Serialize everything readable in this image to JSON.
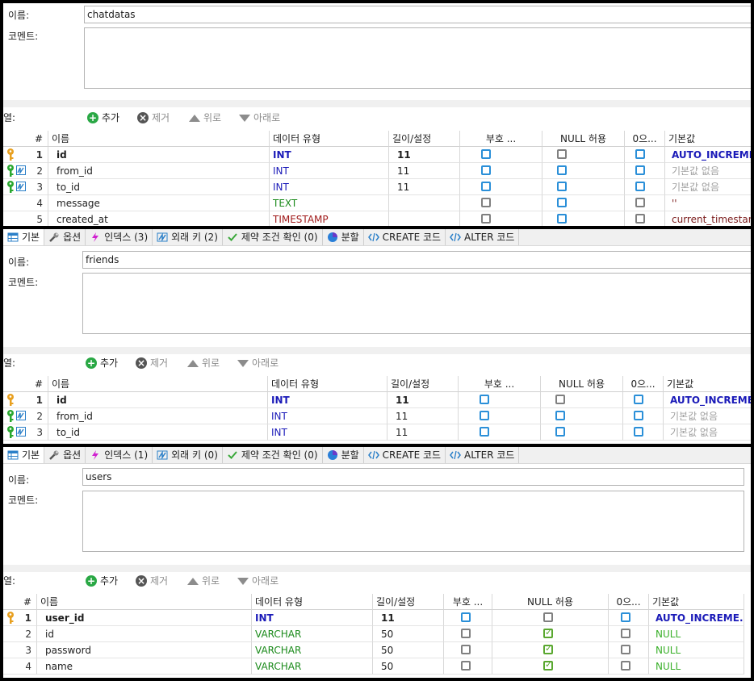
{
  "labels": {
    "name": "이름:",
    "comment": "코멘트:",
    "columns": "열:",
    "add": "추가",
    "remove": "제거",
    "up": "위로",
    "down": "아래로"
  },
  "headers": {
    "num": "#",
    "name": "이름",
    "type": "데이터 유형",
    "length": "길이/설정",
    "unsigned": "부호 ...",
    "nullable": "NULL 허용",
    "zerofill": "0으...",
    "default": "기본값"
  },
  "tabs": [
    {
      "label": "기본",
      "icon": "table-icon"
    },
    {
      "label": "옵션",
      "icon": "wrench-icon"
    },
    {
      "label": "인덱스",
      "icon": "lightning-icon"
    },
    {
      "label": "외래 키",
      "icon": "foreign-key-icon"
    },
    {
      "label": "제약 조건 확인",
      "icon": "check-icon"
    },
    {
      "label": "분할",
      "icon": "pie-icon"
    },
    {
      "label": "CREATE 코드",
      "icon": "code-icon"
    },
    {
      "label": "ALTER 코드",
      "icon": "code-icon"
    }
  ],
  "tables": [
    {
      "name": "chatdatas",
      "columns": [
        {
          "num": "1",
          "name": "id",
          "type": "INT",
          "length": "11",
          "default": "AUTO_INCREME...",
          "key": "primary",
          "unsigned": "blue",
          "nullable": "gray",
          "zerofill": "blue",
          "typeColor": "#1a1ab8",
          "defaultColor": "#1a1ab8",
          "bold": true
        },
        {
          "num": "2",
          "name": "from_id",
          "type": "INT",
          "length": "11",
          "default": "기본값 없음",
          "key": "foreign",
          "unsigned": "blue",
          "nullable": "blue",
          "zerofill": "blue",
          "typeColor": "#1a1ab8",
          "defaultColor": "#a0a0a0",
          "bold": false
        },
        {
          "num": "3",
          "name": "to_id",
          "type": "INT",
          "length": "11",
          "default": "기본값 없음",
          "key": "foreign",
          "unsigned": "blue",
          "nullable": "blue",
          "zerofill": "blue",
          "typeColor": "#1a1ab8",
          "defaultColor": "#a0a0a0",
          "bold": false
        },
        {
          "num": "4",
          "name": "message",
          "type": "TEXT",
          "length": "",
          "default": "''",
          "key": "",
          "unsigned": "gray",
          "nullable": "blue",
          "zerofill": "gray",
          "typeColor": "#1a8a1a",
          "defaultColor": "#7a1a1a",
          "bold": false
        },
        {
          "num": "5",
          "name": "created_at",
          "type": "TIMESTAMP",
          "length": "",
          "default": "current_timestam...",
          "key": "",
          "unsigned": "gray",
          "nullable": "blue",
          "zerofill": "gray",
          "typeColor": "#a01a1a",
          "defaultColor": "#7a1a1a",
          "bold": false
        }
      ]
    },
    {
      "name": "friends",
      "tabCounts": {
        "index": "인덱스 (3)",
        "fk": "외래 키 (2)",
        "check": "제약 조건 확인 (0)"
      },
      "columns": [
        {
          "num": "1",
          "name": "id",
          "type": "INT",
          "length": "11",
          "default": "AUTO_INCREME...",
          "key": "primary",
          "unsigned": "blue",
          "nullable": "gray",
          "zerofill": "blue",
          "typeColor": "#1a1ab8",
          "defaultColor": "#1a1ab8",
          "bold": true
        },
        {
          "num": "2",
          "name": "from_id",
          "type": "INT",
          "length": "11",
          "default": "기본값 없음",
          "key": "foreign",
          "unsigned": "blue",
          "nullable": "blue",
          "zerofill": "blue",
          "typeColor": "#1a1ab8",
          "defaultColor": "#a0a0a0",
          "bold": false
        },
        {
          "num": "3",
          "name": "to_id",
          "type": "INT",
          "length": "11",
          "default": "기본값 없음",
          "key": "foreign",
          "unsigned": "blue",
          "nullable": "blue",
          "zerofill": "blue",
          "typeColor": "#1a1ab8",
          "defaultColor": "#a0a0a0",
          "bold": false
        }
      ]
    },
    {
      "name": "users",
      "tabCounts": {
        "index": "인덱스 (1)",
        "fk": "외래 키 (0)",
        "check": "제약 조건 확인 (0)"
      },
      "columns": [
        {
          "num": "1",
          "name": "user_id",
          "type": "INT",
          "length": "11",
          "default": "AUTO_INCREME...",
          "key": "primary",
          "unsigned": "blue",
          "nullable": "gray",
          "zerofill": "blue",
          "typeColor": "#1a1ab8",
          "defaultColor": "#1a1ab8",
          "bold": true
        },
        {
          "num": "2",
          "name": "id",
          "type": "VARCHAR",
          "length": "50",
          "default": "NULL",
          "key": "",
          "unsigned": "gray",
          "nullable": "green",
          "zerofill": "gray",
          "typeColor": "#1a8a1a",
          "defaultColor": "#3ab02a",
          "bold": false
        },
        {
          "num": "3",
          "name": "password",
          "type": "VARCHAR",
          "length": "50",
          "default": "NULL",
          "key": "",
          "unsigned": "gray",
          "nullable": "green",
          "zerofill": "gray",
          "typeColor": "#1a8a1a",
          "defaultColor": "#3ab02a",
          "bold": false
        },
        {
          "num": "4",
          "name": "name",
          "type": "VARCHAR",
          "length": "50",
          "default": "NULL",
          "key": "",
          "unsigned": "gray",
          "nullable": "green",
          "zerofill": "gray",
          "typeColor": "#1a8a1a",
          "defaultColor": "#3ab02a",
          "bold": false
        }
      ]
    }
  ]
}
